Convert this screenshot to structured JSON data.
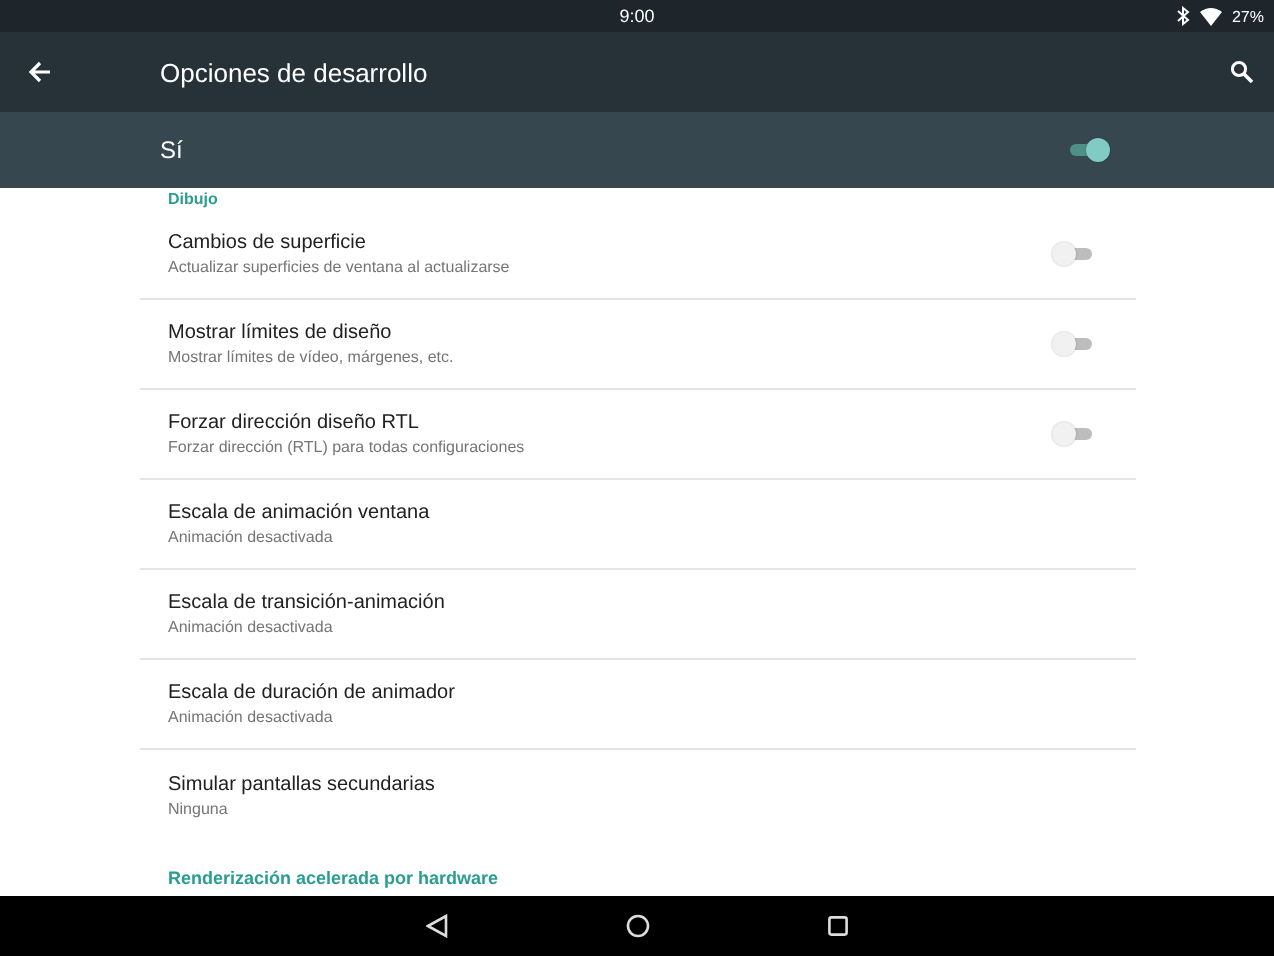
{
  "status_bar": {
    "time": "9:00",
    "battery": "27%"
  },
  "toolbar": {
    "title": "Opciones de desarrollo"
  },
  "master_switch": {
    "label": "Sí",
    "on": true
  },
  "sections": [
    {
      "header": "Dibujo",
      "items": [
        {
          "kind": "toggle",
          "title": "Cambios de superficie",
          "summary": "Actualizar superficies de ventana al actualizarse",
          "on": false
        },
        {
          "kind": "toggle",
          "title": "Mostrar límites de diseño",
          "summary": "Mostrar límites de vídeo, márgenes, etc.",
          "on": false
        },
        {
          "kind": "toggle",
          "title": "Forzar dirección diseño RTL",
          "summary": "Forzar dirección (RTL) para todas configuraciones",
          "on": false
        },
        {
          "kind": "plain",
          "title": "Escala de animación ventana",
          "summary": "Animación desactivada"
        },
        {
          "kind": "plain",
          "title": "Escala de transición-animación",
          "summary": "Animación desactivada"
        },
        {
          "kind": "plain",
          "title": "Escala de duración de animador",
          "summary": "Animación desactivada"
        },
        {
          "kind": "plain",
          "title": "Simular pantallas secundarias",
          "summary": "Ninguna"
        }
      ]
    },
    {
      "header": "Renderización acelerada por hardware"
    }
  ]
}
